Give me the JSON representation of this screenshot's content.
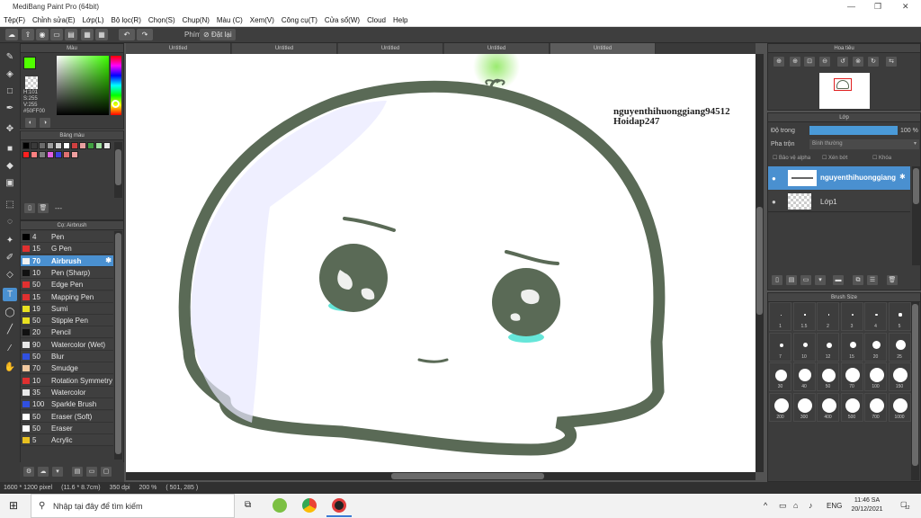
{
  "app": {
    "title": "MediBang Paint Pro (64bit)"
  },
  "menu": [
    "Tệp(F)",
    "Chỉnh sửa(E)",
    "Lớp(L)",
    "Bộ lọc(R)",
    "Chọn(S)",
    "Chụp(N)",
    "Màu (C)",
    "Xem(V)",
    "Công cụ(T)",
    "Cửa sổ(W)",
    "Cloud",
    "Help"
  ],
  "toolbar": {
    "snap_label": "Phím",
    "reset_label": "Đặt lại"
  },
  "doc_tabs": [
    "Untitled",
    "Untitled",
    "Untitled",
    "Untitled",
    "Untitled"
  ],
  "color_panel": {
    "title": "Màu",
    "h": "H:101",
    "s": "S:255",
    "v": "V:255",
    "hex": "#50FF00",
    "fg_color": "#50FF00"
  },
  "palette": {
    "title": "Bảng màu",
    "label": "---",
    "colors": [
      "#000000",
      "#3a3a3a",
      "#6b6b6b",
      "#9e9e9e",
      "#d0d0d0",
      "#ffffff",
      "#d04040",
      "#e8a0a0",
      "#40a040",
      "#a0e0a0",
      "#e8e8e8",
      "#ff2020",
      "#ff8080",
      "#808080",
      "#e060e0",
      "#4040e0",
      "#e07070",
      "#f0a0a0"
    ]
  },
  "brush_panel": {
    "title": "Cọ: Airbrush",
    "brushes": [
      {
        "size": "4",
        "name": "Pen",
        "color": "#000000"
      },
      {
        "size": "15",
        "name": "G Pen",
        "color": "#e03030"
      },
      {
        "size": "70",
        "name": "Airbrush",
        "color": "#f0f0f0",
        "selected": true
      },
      {
        "size": "10",
        "name": "Pen (Sharp)",
        "color": "#111111"
      },
      {
        "size": "50",
        "name": "Edge Pen",
        "color": "#e03030"
      },
      {
        "size": "15",
        "name": "Mapping Pen",
        "color": "#e03030"
      },
      {
        "size": "19",
        "name": "Sumi",
        "color": "#e8e020"
      },
      {
        "size": "50",
        "name": "Stipple Pen",
        "color": "#e8e020"
      },
      {
        "size": "20",
        "name": "Pencil",
        "color": "#111111"
      },
      {
        "size": "90",
        "name": "Watercolor (Wet)",
        "color": "#e8e8e8"
      },
      {
        "size": "50",
        "name": "Blur",
        "color": "#3050e0"
      },
      {
        "size": "70",
        "name": "Smudge",
        "color": "#f0c8a0"
      },
      {
        "size": "10",
        "name": "Rotation Symmetry",
        "color": "#e03030"
      },
      {
        "size": "35",
        "name": "Watercolor",
        "color": "#e8e8e8"
      },
      {
        "size": "100",
        "name": "Sparkle Brush",
        "color": "#3050e0"
      },
      {
        "size": "50",
        "name": "Eraser (Soft)",
        "color": "#ffffff"
      },
      {
        "size": "50",
        "name": "Eraser",
        "color": "#ffffff"
      },
      {
        "size": "5",
        "name": "Acrylic",
        "color": "#e8c020"
      }
    ]
  },
  "navigator": {
    "title": "Hoa tiêu"
  },
  "layers": {
    "title": "Lớp",
    "opacity_label": "Độ trong",
    "opacity_value": "100 %",
    "opacity_fraction": 1.0,
    "blend_label": "Pha trộn",
    "blend_value": "Bình thường",
    "protect_alpha": "Bảo vệ alpha",
    "clipping": "Xén bớt",
    "lock": "Khóa",
    "items": [
      {
        "name": "nguyenthihuonggiang",
        "selected": true
      },
      {
        "name": "Lớp1",
        "selected": false
      }
    ]
  },
  "brush_size": {
    "title": "Brush Size",
    "sizes": [
      "1",
      "1.5",
      "2",
      "3",
      "4",
      "5",
      "7",
      "10",
      "12",
      "15",
      "20",
      "25",
      "30",
      "40",
      "50",
      "70",
      "100",
      "150",
      "200",
      "300",
      "400",
      "500",
      "700",
      "1000"
    ]
  },
  "canvas": {
    "watermark_line1": "nguyenthihuonggiang94512",
    "watermark_line2": "Hoidap247",
    "body_color": "#5a6a56",
    "eye_glow_color": "#40e0d0",
    "leaf_color": "#50c020"
  },
  "status": {
    "size": "1600 * 1200 pixel",
    "cm": "(11.6 * 8.7cm)",
    "dpi": "350 dpi",
    "zoom": "200 %",
    "coords": "( 501, 285 )"
  },
  "taskbar": {
    "search_placeholder": "Nhập tại đây để tìm kiếm",
    "lang": "ENG",
    "time": "11:46 SA",
    "date": "20/12/2021",
    "notif_count": "12"
  }
}
